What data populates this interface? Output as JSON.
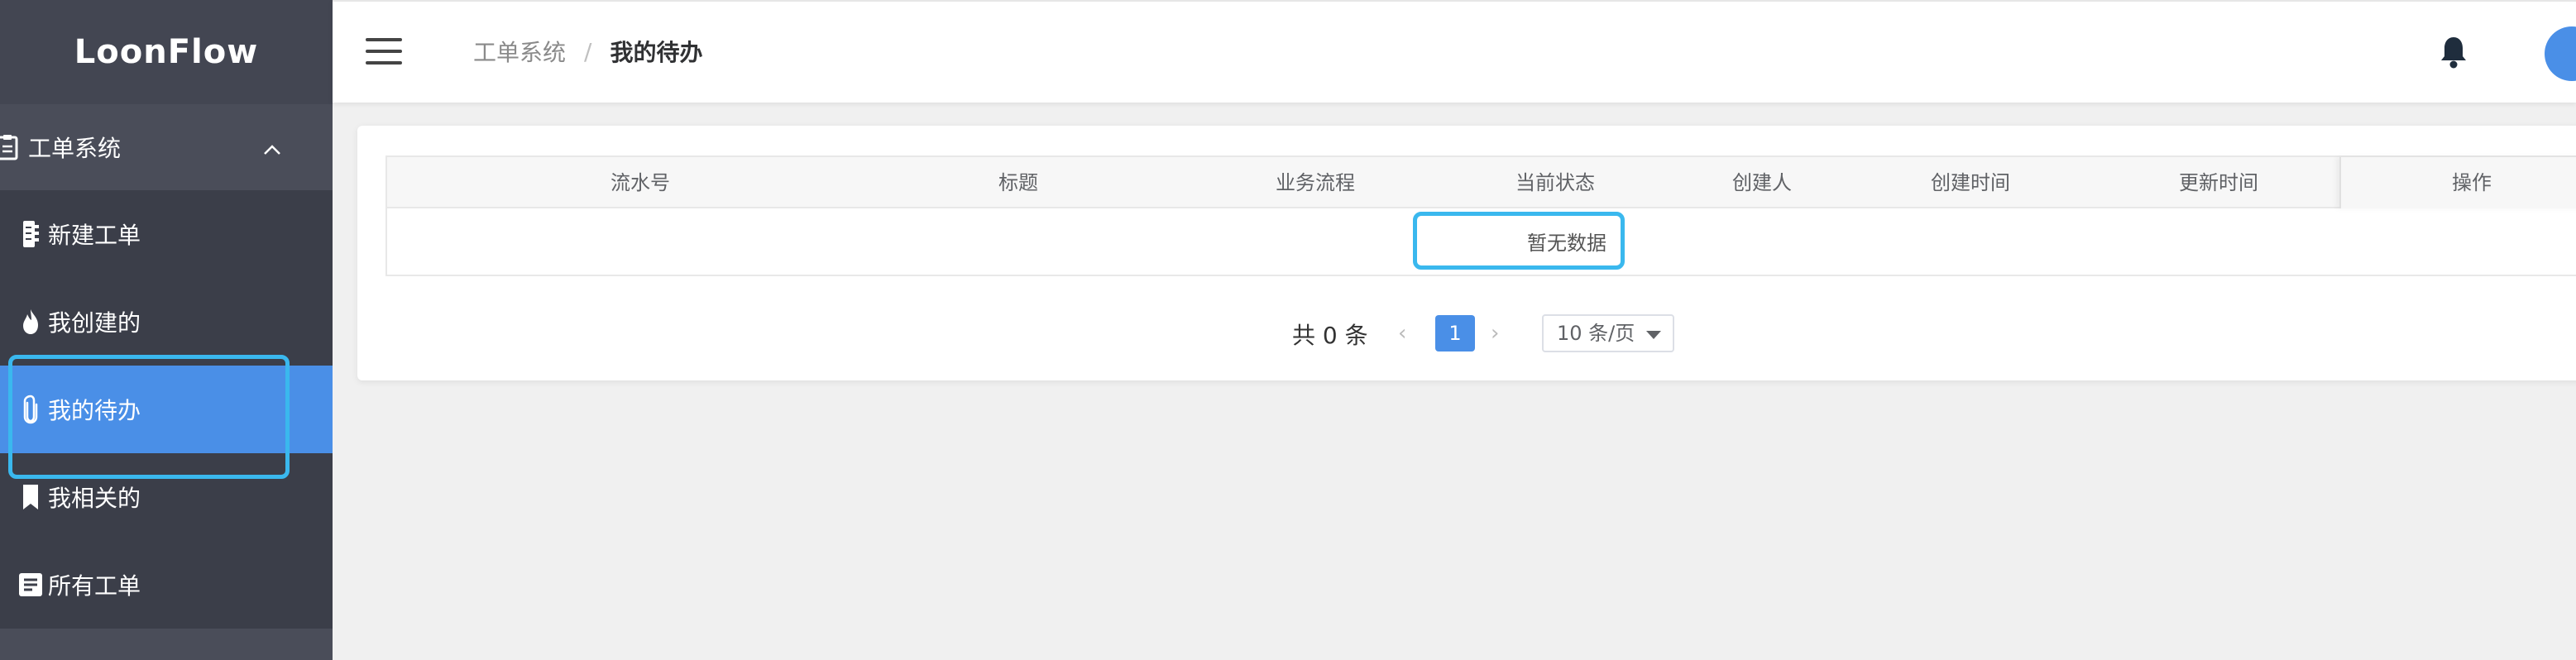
{
  "app": {
    "brand": "LoonFlow"
  },
  "sidebar": {
    "group_label": "工单系统",
    "items": [
      {
        "label": "新建工单",
        "icon": "form-icon"
      },
      {
        "label": "我创建的",
        "icon": "fire-icon"
      },
      {
        "label": "我的待办",
        "icon": "paperclip-icon",
        "active": true
      },
      {
        "label": "我相关的",
        "icon": "bookmark-icon"
      },
      {
        "label": "所有工单",
        "icon": "list-icon"
      }
    ]
  },
  "header": {
    "breadcrumb": [
      "工单系统",
      "我的待办"
    ],
    "breadcrumb_sep": "/"
  },
  "table": {
    "columns": [
      "流水号",
      "标题",
      "业务流程",
      "当前状态",
      "创建人",
      "创建时间",
      "更新时间",
      "操作"
    ],
    "empty_text": "暂无数据"
  },
  "pagination": {
    "total_text": "共 0 条",
    "current_page": "1",
    "page_size": "10 条/页"
  },
  "colors": {
    "sidebar_bg": "#3b3e49",
    "active_bg": "#4a8fe7",
    "highlight": "#3ab8ee"
  }
}
